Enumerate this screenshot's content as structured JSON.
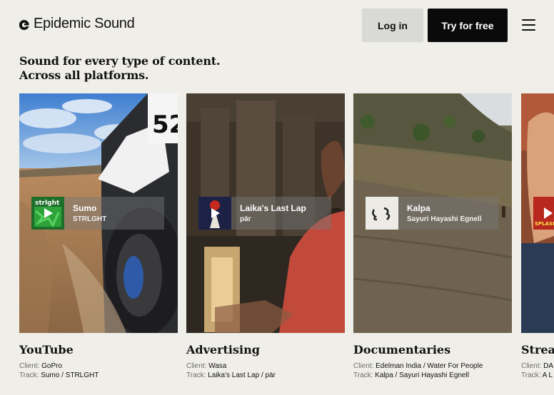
{
  "header": {
    "logo_text": "Epidemic Sound",
    "login_label": "Log in",
    "try_label": "Try for free"
  },
  "headline": {
    "line1": "Sound for every type of content.",
    "line2": "Across all platforms."
  },
  "cards": [
    {
      "category": "YouTube",
      "track_title": "Sumo",
      "track_artist": "STRLGHT",
      "client_label": "Client:",
      "client": "GoPro",
      "track_label": "Track:",
      "track": "Sumo / STRLGHT",
      "art_text": "strlght"
    },
    {
      "category": "Advertising",
      "track_title": "Laika's Last Lap",
      "track_artist": "pär",
      "client_label": "Client:",
      "client": "Wasa",
      "track_label": "Track:",
      "track": "Laika's Last Lap / pär"
    },
    {
      "category": "Documentaries",
      "track_title": "Kalpa",
      "track_artist": "Sayuri Hayashi Egnell",
      "client_label": "Client:",
      "client": "Edelman India / Water For People",
      "track_label": "Track:",
      "track": "Kalpa / Sayuri Hayashi Egnell"
    },
    {
      "category": "Strea",
      "client_label": "Client:",
      "client": "DA",
      "track_label": "Track:",
      "track": "A L",
      "art_text": "SPLASH"
    }
  ],
  "icons": {
    "logo": "epidemic-sound-logo-icon",
    "menu": "hamburger-menu-icon",
    "play": "play-icon"
  },
  "colors": {
    "background": "#efeee9",
    "primary_button": "#0a0a0a",
    "secondary_button": "#d9d9d6"
  }
}
